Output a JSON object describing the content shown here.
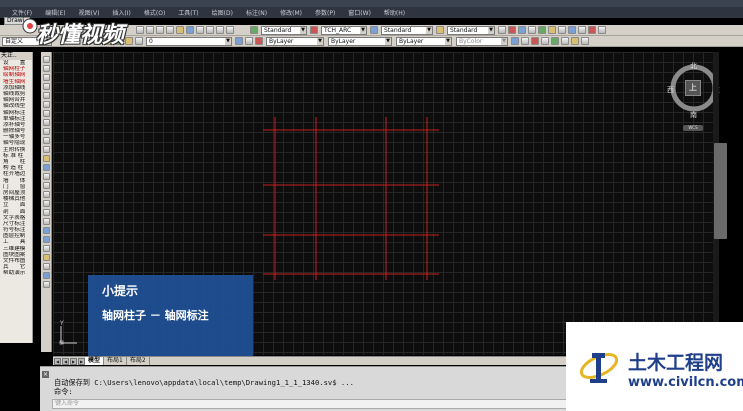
{
  "app": {
    "doc_tab": "Drawi"
  },
  "watermark": {
    "text": "秒懂视频"
  },
  "menu": [
    "文件(F)",
    "编辑(E)",
    "视图(V)",
    "插入(I)",
    "格式(O)",
    "工具(T)",
    "绘图(D)",
    "标注(N)",
    "修改(M)",
    "参数(P)",
    "窗口(W)",
    "帮助(H)"
  ],
  "toolbar": {
    "text_style": "Standard",
    "tch_style": "TCH_ARC",
    "dim_style": "Standard",
    "table_style": "Standard",
    "workspace": "自定义",
    "layer": "0",
    "color": "ByLayer",
    "linetype": "ByLayer",
    "lineweight": "ByLayer",
    "plotstyle": "ByColor"
  },
  "left_panel": {
    "title": "天正..",
    "items": [
      "设　　置",
      "轴网柱子",
      "绘制轴网",
      "墙生轴网",
      "添加轴线",
      "轴线裁剪",
      "轴网合并",
      "轴改线型",
      "轴网标注",
      "单轴标注",
      "添补轴号",
      "删除轴号",
      "一轴多号",
      "轴号隐现",
      "主附转换",
      "标 准 柱",
      "角　　柱",
      "构 造 柱",
      "柱齐墙边",
      "墙　　体",
      "门　　窗",
      "房间屋顶",
      "楼梯其他",
      "立　　面",
      "剖　　面",
      "文字表格",
      "尺寸标注",
      "符号标注",
      "图层控制",
      "工　　具",
      "三维建模",
      "图块图案",
      "文件布图",
      "其　　它",
      "帮助演示"
    ]
  },
  "compass": {
    "north": "北",
    "south": "南",
    "west": "西",
    "east": "东",
    "center": "上",
    "wcs": "WCS"
  },
  "tip": {
    "title": "小提示",
    "body": "轴网柱子 － 轴网标注"
  },
  "ucs": {
    "y_label": "Y"
  },
  "layout_tabs": [
    "模型",
    "布局1",
    "布局2"
  ],
  "command": {
    "history": "自动保存到 C:\\Users\\lenovo\\appdata\\local\\temp\\Drawing1_1_1_1340.sv$ ...",
    "prompt": "命令:",
    "placeholder": "键入命令"
  },
  "site_logo": {
    "name": "土木工程网",
    "url": "www.civilcn.com"
  },
  "colors": {
    "axis_line": "#c62020",
    "tip_bg": "#1e5096",
    "logo_blue": "#1f3f8a"
  }
}
